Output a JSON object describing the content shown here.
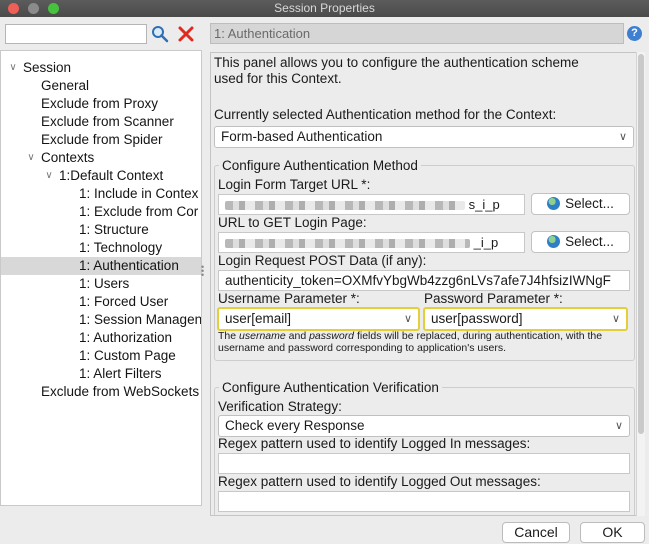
{
  "window": {
    "title": "Session Properties"
  },
  "search": {
    "value": "",
    "placeholder": ""
  },
  "tree": [
    {
      "label": "Session",
      "level": 0,
      "expanded": true
    },
    {
      "label": "General",
      "level": 1
    },
    {
      "label": "Exclude from Proxy",
      "level": 1
    },
    {
      "label": "Exclude from Scanner",
      "level": 1
    },
    {
      "label": "Exclude from Spider",
      "level": 1
    },
    {
      "label": "Contexts",
      "level": 1,
      "expanded": true
    },
    {
      "label": "1:Default Context",
      "level": 2,
      "expanded": true
    },
    {
      "label": "1: Include in Contex",
      "level": 3
    },
    {
      "label": "1: Exclude from Cor",
      "level": 3
    },
    {
      "label": "1: Structure",
      "level": 3
    },
    {
      "label": "1: Technology",
      "level": 3
    },
    {
      "label": "1: Authentication",
      "level": 3,
      "selected": true
    },
    {
      "label": "1: Users",
      "level": 3
    },
    {
      "label": "1: Forced User",
      "level": 3
    },
    {
      "label": "1: Session Managen",
      "level": 3
    },
    {
      "label": "1: Authorization",
      "level": 3
    },
    {
      "label": "1: Custom Page",
      "level": 3
    },
    {
      "label": "1: Alert Filters",
      "level": 3
    },
    {
      "label": "Exclude from WebSockets",
      "level": 1
    }
  ],
  "panel": {
    "header": "1: Authentication",
    "intro_line1": "This panel allows you to configure the authentication scheme",
    "intro_line2": "used for this Context.",
    "method_label": "Currently selected Authentication method for the Context:",
    "method_value": "Form-based Authentication",
    "configure": {
      "title": "Configure Authentication Method",
      "login_url_label": "Login Form Target URL *:",
      "login_url_tail": "s_i_p",
      "select_label": "Select...",
      "get_url_label": "URL to GET Login Page:",
      "get_url_tail": "_i_p",
      "post_label": "Login Request POST Data (if any):",
      "post_value": "authenticity_token=OXMfvYbgWb4zzg6nLVs7afe7J4hfsizIWNgF",
      "username_label": "Username Parameter *:",
      "username_value": "user[email]",
      "password_label": "Password Parameter *:",
      "password_value": "user[password]",
      "note_the": "The ",
      "note_username": "username",
      "note_and": " and ",
      "note_password": "password",
      "note_rest1": " fields will be replaced, during authentication, with the",
      "note_line2": "username and password corresponding to application's users."
    },
    "verification": {
      "title": "Configure Authentication Verification",
      "strategy_label": "Verification Strategy:",
      "strategy_value": "Check every Response",
      "logged_in_label": "Regex pattern used to identify Logged In messages:",
      "logged_in_value": "",
      "logged_out_label": "Regex pattern used to identify Logged Out messages:",
      "logged_out_value": ""
    }
  },
  "footer": {
    "cancel_label": "Cancel",
    "ok_label": "OK"
  },
  "icons": {
    "search": "magnifier-icon",
    "clear": "red-x-icon",
    "help": "help-icon",
    "globe": "globe-icon"
  },
  "colors": {
    "highlight": "#e2cf3a",
    "selected_row": "#d8d8d8",
    "help_blue": "#3f7fd2"
  }
}
